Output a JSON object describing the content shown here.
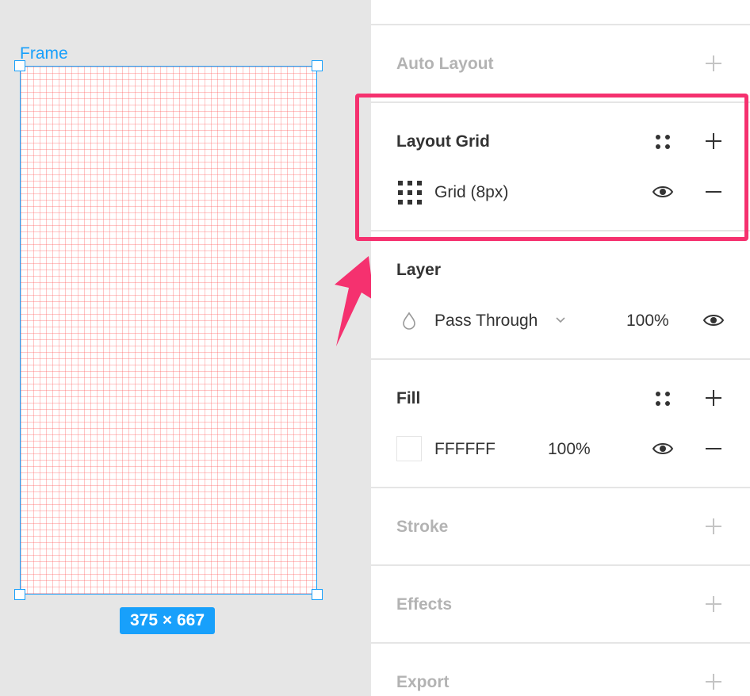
{
  "canvas": {
    "frame_label": "Frame",
    "size_badge": "375 × 667"
  },
  "panel": {
    "auto_layout": {
      "title": "Auto Layout"
    },
    "layout_grid": {
      "title": "Layout Grid",
      "grid_item": "Grid (8px)"
    },
    "layer": {
      "title": "Layer",
      "blend_mode": "Pass Through",
      "opacity": "100%"
    },
    "fill": {
      "title": "Fill",
      "color_hex": "FFFFFF",
      "opacity": "100%",
      "swatch": "#FFFFFF"
    },
    "stroke": {
      "title": "Stroke"
    },
    "effects": {
      "title": "Effects"
    },
    "export": {
      "title": "Export"
    }
  },
  "colors": {
    "selection": "#18A0FB",
    "highlight": "#F5316F",
    "grid_line": "#FF5A5A"
  },
  "icons": [
    "plus-icon",
    "minus-icon",
    "eye-icon",
    "style-dots-icon",
    "grid-icon",
    "droplet-icon",
    "chevron-down-icon",
    "arrow-icon"
  ]
}
